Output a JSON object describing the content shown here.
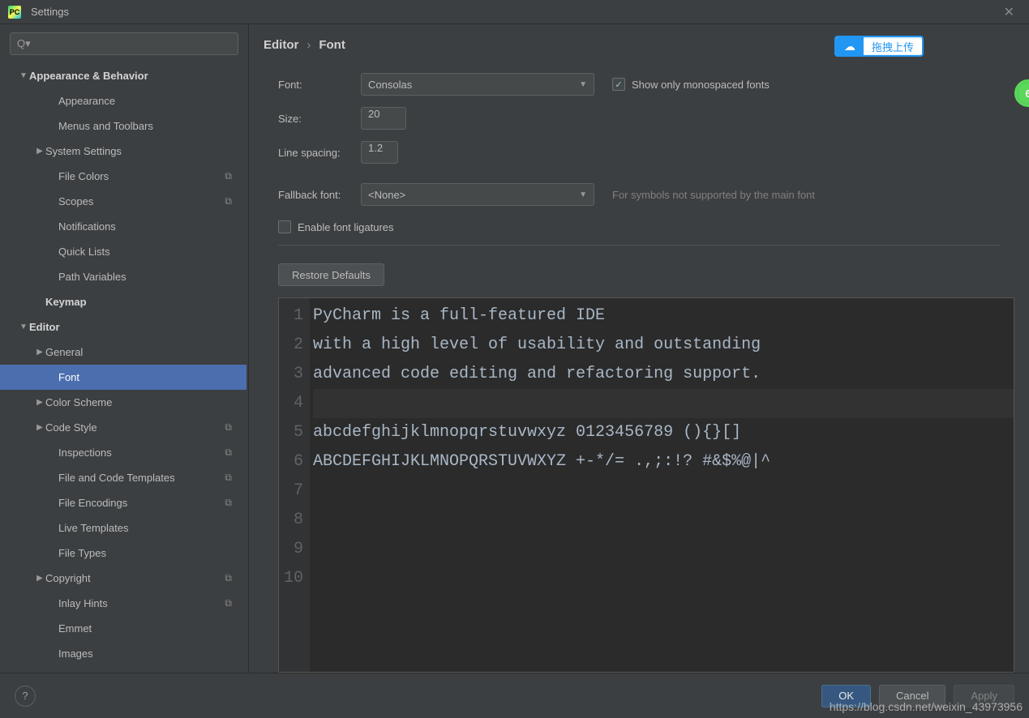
{
  "window": {
    "title": "Settings",
    "close": "✕"
  },
  "search": {
    "placeholder": ""
  },
  "tree": [
    {
      "label": "Appearance & Behavior",
      "bold": true,
      "arrow": "▼",
      "indent": 1
    },
    {
      "label": "Appearance",
      "indent": 3
    },
    {
      "label": "Menus and Toolbars",
      "indent": 3
    },
    {
      "label": "System Settings",
      "arrow": "▶",
      "indent": 2
    },
    {
      "label": "File Colors",
      "indent": 3,
      "scope": true
    },
    {
      "label": "Scopes",
      "indent": 3,
      "scope": true
    },
    {
      "label": "Notifications",
      "indent": 3
    },
    {
      "label": "Quick Lists",
      "indent": 3
    },
    {
      "label": "Path Variables",
      "indent": 3
    },
    {
      "label": "Keymap",
      "bold": true,
      "indent": 2
    },
    {
      "label": "Editor",
      "bold": true,
      "arrow": "▼",
      "indent": 1
    },
    {
      "label": "General",
      "arrow": "▶",
      "indent": 2
    },
    {
      "label": "Font",
      "indent": 3,
      "selected": true
    },
    {
      "label": "Color Scheme",
      "arrow": "▶",
      "indent": 2
    },
    {
      "label": "Code Style",
      "arrow": "▶",
      "indent": 2,
      "scope": true
    },
    {
      "label": "Inspections",
      "indent": 3,
      "scope": true
    },
    {
      "label": "File and Code Templates",
      "indent": 3,
      "scope": true
    },
    {
      "label": "File Encodings",
      "indent": 3,
      "scope": true
    },
    {
      "label": "Live Templates",
      "indent": 3
    },
    {
      "label": "File Types",
      "indent": 3
    },
    {
      "label": "Copyright",
      "arrow": "▶",
      "indent": 2,
      "scope": true
    },
    {
      "label": "Inlay Hints",
      "indent": 3,
      "scope": true
    },
    {
      "label": "Emmet",
      "indent": 3
    },
    {
      "label": "Images",
      "indent": 3
    }
  ],
  "breadcrumb": {
    "root": "Editor",
    "sep": "›",
    "leaf": "Font"
  },
  "form": {
    "font_label": "Font:",
    "font_value": "Consolas",
    "size_label": "Size:",
    "size_value": "20",
    "spacing_label": "Line spacing:",
    "spacing_value": "1.2",
    "fallback_label": "Fallback font:",
    "fallback_value": "<None>",
    "fallback_hint": "For symbols not supported by the main font",
    "mono_checkbox": "Show only monospaced fonts",
    "ligatures_checkbox": "Enable font ligatures",
    "restore": "Restore Defaults"
  },
  "preview": {
    "lines": [
      "PyCharm is a full-featured IDE",
      "with a high level of usability and outstanding",
      "advanced code editing and refactoring support.",
      "",
      "abcdefghijklmnopqrstuvwxyz 0123456789 (){}[]",
      "ABCDEFGHIJKLMNOPQRSTUVWXYZ +-*/= .,;:!? #&$%@|^",
      "",
      "",
      "",
      ""
    ]
  },
  "footer": {
    "ok": "OK",
    "cancel": "Cancel",
    "apply": "Apply"
  },
  "upload_widget": "拖拽上传",
  "badge": "6",
  "watermark": "https://blog.csdn.net/weixin_43973956"
}
